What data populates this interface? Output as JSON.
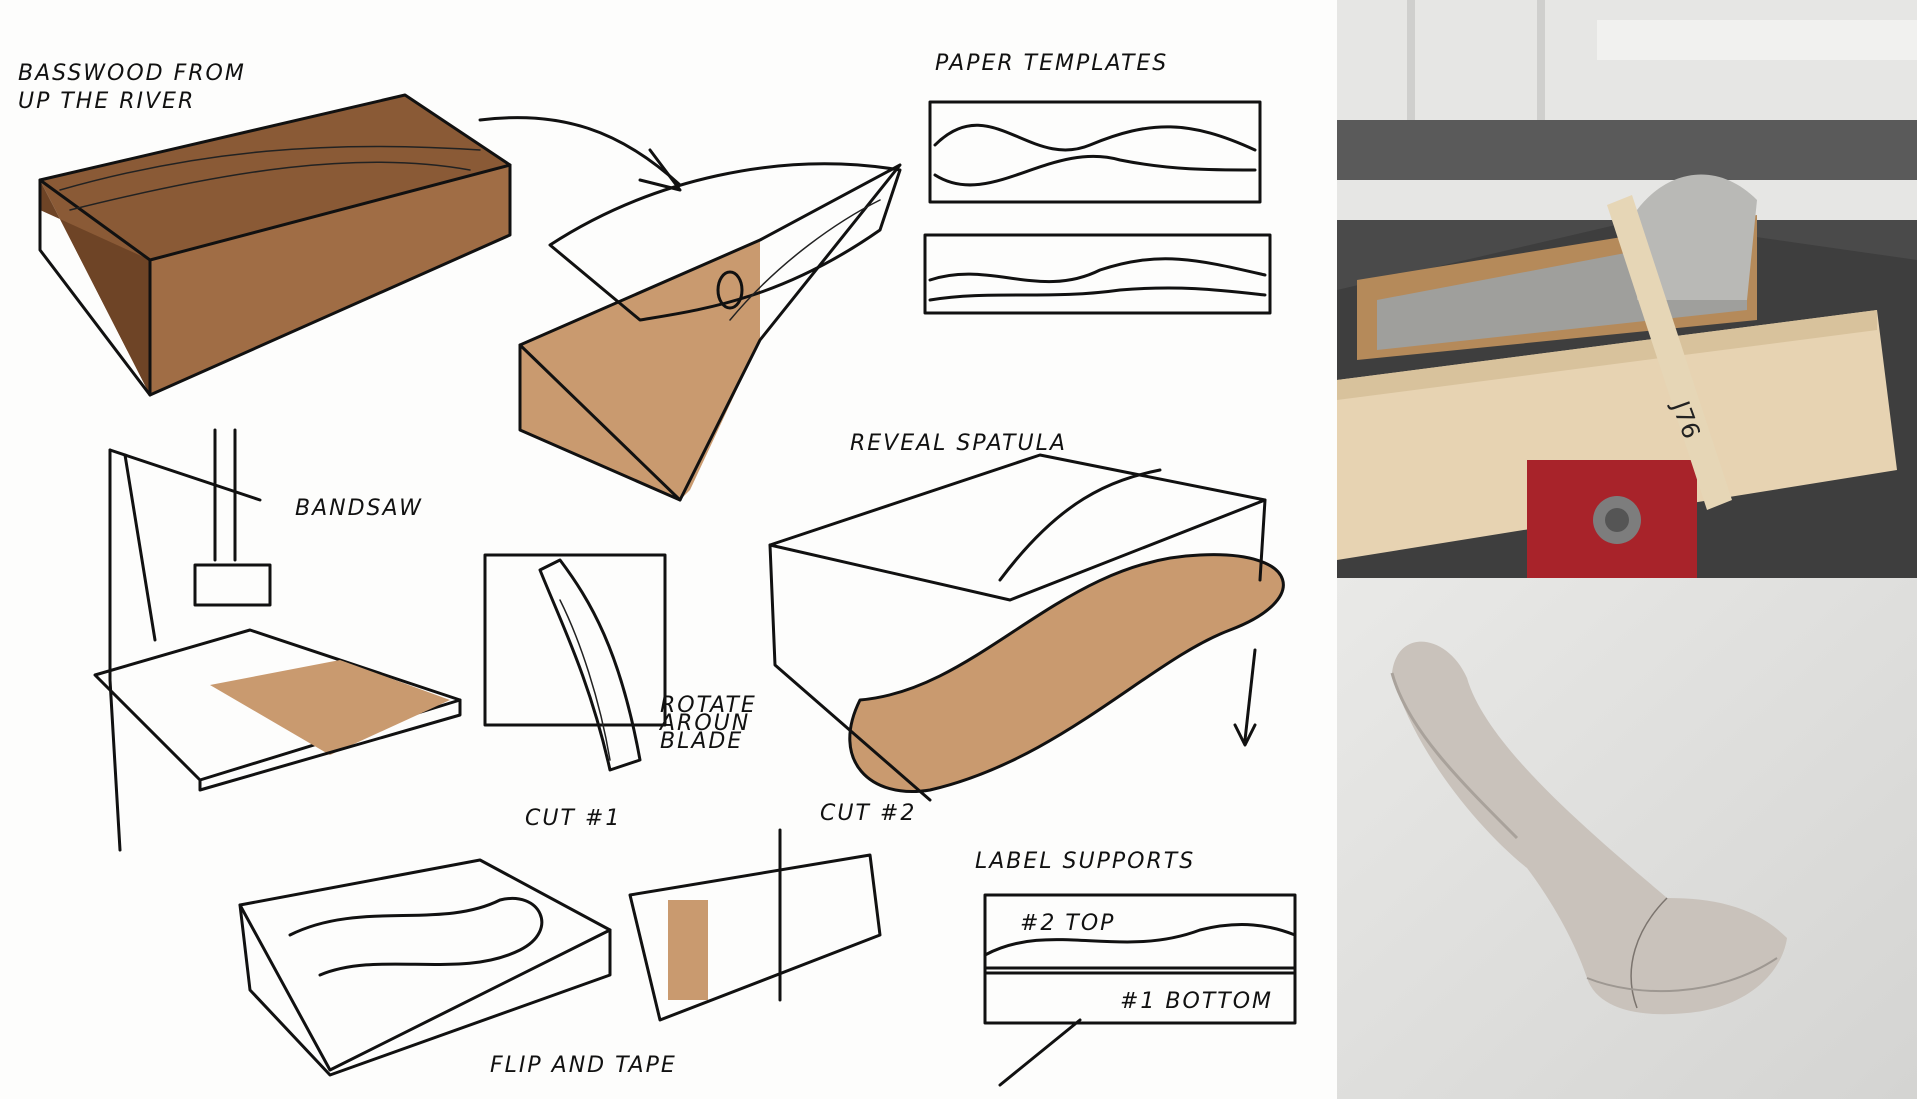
{
  "sketch": {
    "labels": {
      "basswood_line1": "BASSWOOD FROM",
      "basswood_line2": "UP THE RIVER",
      "paper_templates": "PAPER TEMPLATES",
      "bandsaw": "BANDSAW",
      "reveal_spatula": "REVEAL SPATULA",
      "rotate_line1": "ROTATE",
      "rotate_line2": "AROUN",
      "rotate_line3": "BLADE",
      "cut1": "CUT #1",
      "cut2": "CUT #2",
      "label_supports": "LABEL SUPPORTS",
      "top_label": "#2 TOP",
      "bottom_label": "#1 BOTTOM",
      "flip_tape": "FLIP AND TAPE"
    }
  },
  "photos": {
    "vise_dowel_mark": "J76"
  },
  "colors": {
    "ink": "#111111",
    "wood_dark": "#8a5a36",
    "wood_light": "#c99a6f",
    "vise_red": "#a8232a",
    "foam_gray": "#b9b9b6"
  }
}
